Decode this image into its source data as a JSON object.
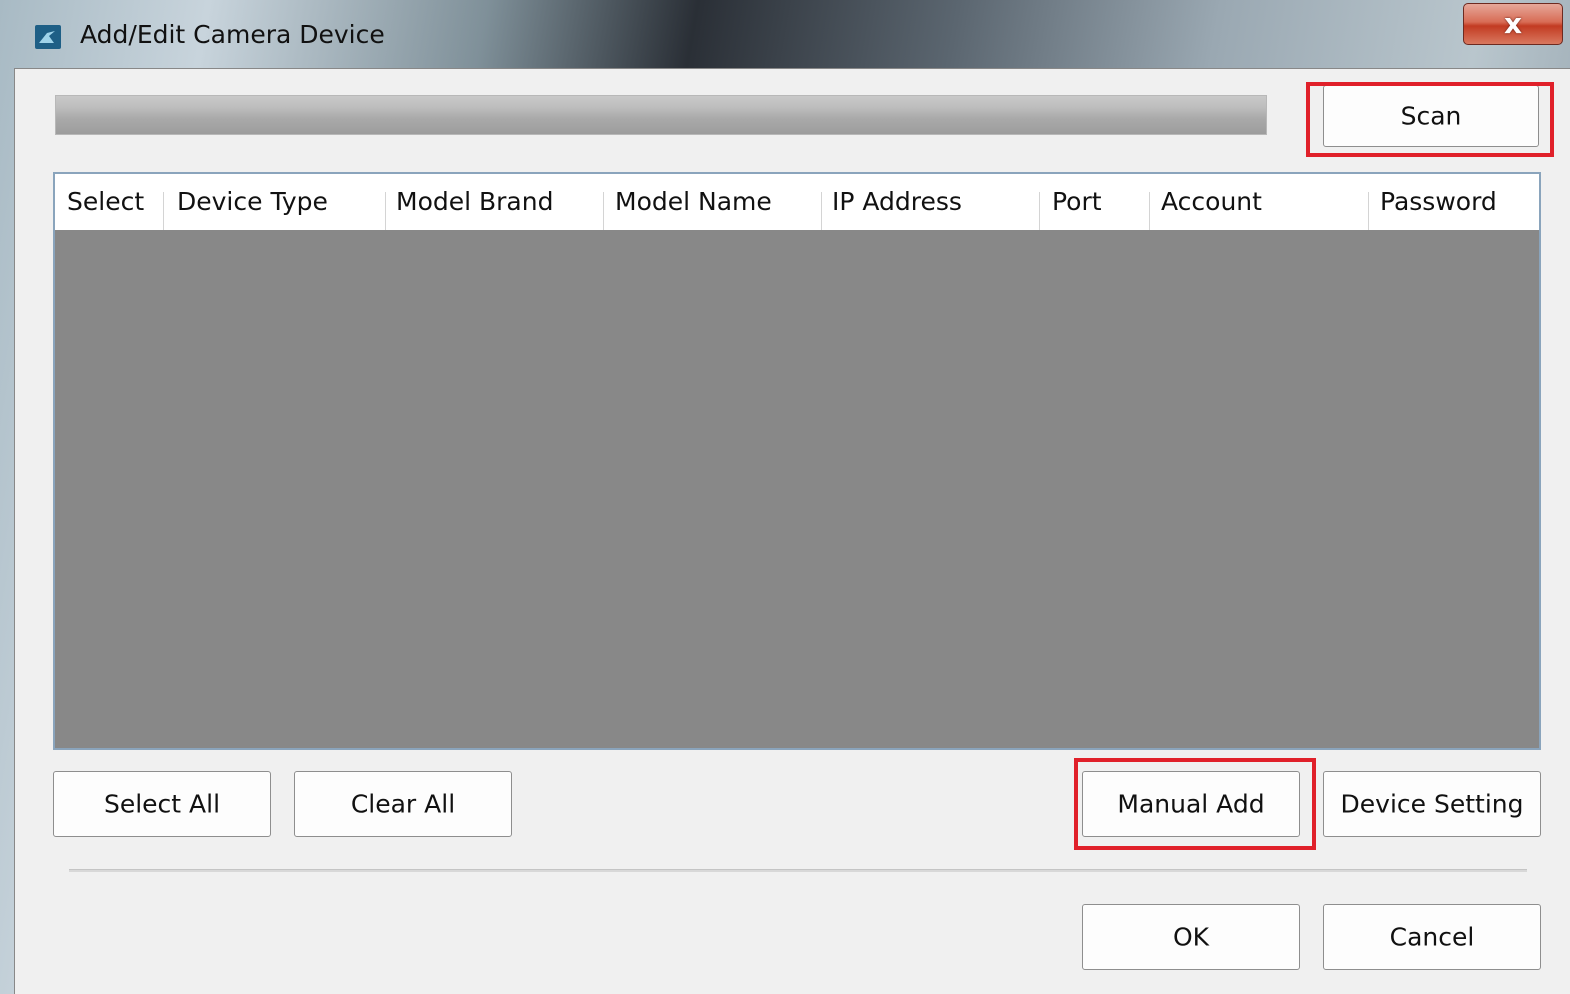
{
  "window": {
    "title": "Add/Edit Camera Device",
    "close_label": "x",
    "frame_colors": {
      "accent_close": "#c23b22",
      "highlight": "#e0202a",
      "table_empty": "#888888"
    }
  },
  "toolbar": {
    "scan_label": "Scan"
  },
  "table": {
    "columns": [
      "Select",
      "Device Type",
      "Model Brand",
      "Model Name",
      "IP Address",
      "Port",
      "Account",
      "Password"
    ],
    "rows": []
  },
  "actions": {
    "select_all_label": "Select All",
    "clear_all_label": "Clear All",
    "manual_add_label": "Manual Add",
    "device_setting_label": "Device Setting"
  },
  "footer": {
    "ok_label": "OK",
    "cancel_label": "Cancel"
  },
  "icons": {
    "app": "camera-app-icon",
    "close": "close-icon"
  }
}
